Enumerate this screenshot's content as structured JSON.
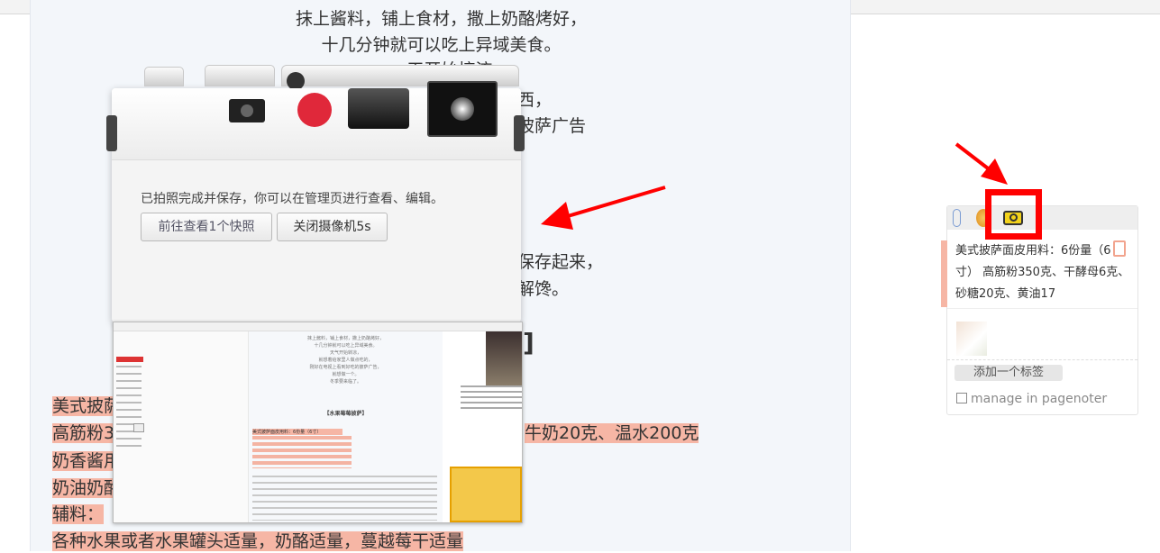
{
  "article": {
    "lines_top": [
      "抹上酱料，铺上食材，撒上奶酪烤好，",
      "十几分钟就可以吃上异域美食。",
      "一天开始搞流"
    ],
    "partial_right": [
      "西，",
      "披萨广告",
      "保存起来，",
      "解馋。"
    ],
    "highlight_lines": [
      "美式披萨",
      "高筋粉3",
      "牛奶20克、温水200克",
      "奶香酱用",
      "奶油奶酪",
      "辅料：",
      "各种水果或者水果罐头适量，奶酪适量，蔓越莓干适量"
    ]
  },
  "camera": {
    "message": "已拍照完成并保存，你可以在管理页进行查看、编辑。",
    "view_button": "前往查看1个快照",
    "close_button": "关闭摄像机5s"
  },
  "snapshot": {
    "title": "【水果莓莓披萨】",
    "lines": [
      "抹上酱料，铺上食材，撒上奶酪烤好，",
      "十几分钟就可以吃上异域美食。",
      "天气开始转凉，",
      "就想着给家里人做点吃的，",
      "刚好在电视上看到好吃的披萨广告，",
      "就想做一个。",
      "冬季要来临了。",
      "美式披萨面皮用料：6份量（6寸）"
    ]
  },
  "pagenoter": {
    "note": "美式披萨面皮用料：6份量（6寸） 高筋粉350克、干酵母6克、砂糖20克、黄油17",
    "add_tag": "添加一个标签",
    "manage": "manage in pagenoter"
  },
  "colors": {
    "highlight": "#f6b6a5",
    "annotation_red": "#ff0000",
    "camera_red": "#e0283a"
  },
  "icons": [
    "mic-icon",
    "light-bulb-icon",
    "camera-icon",
    "trash-icon",
    "external-link-icon"
  ]
}
